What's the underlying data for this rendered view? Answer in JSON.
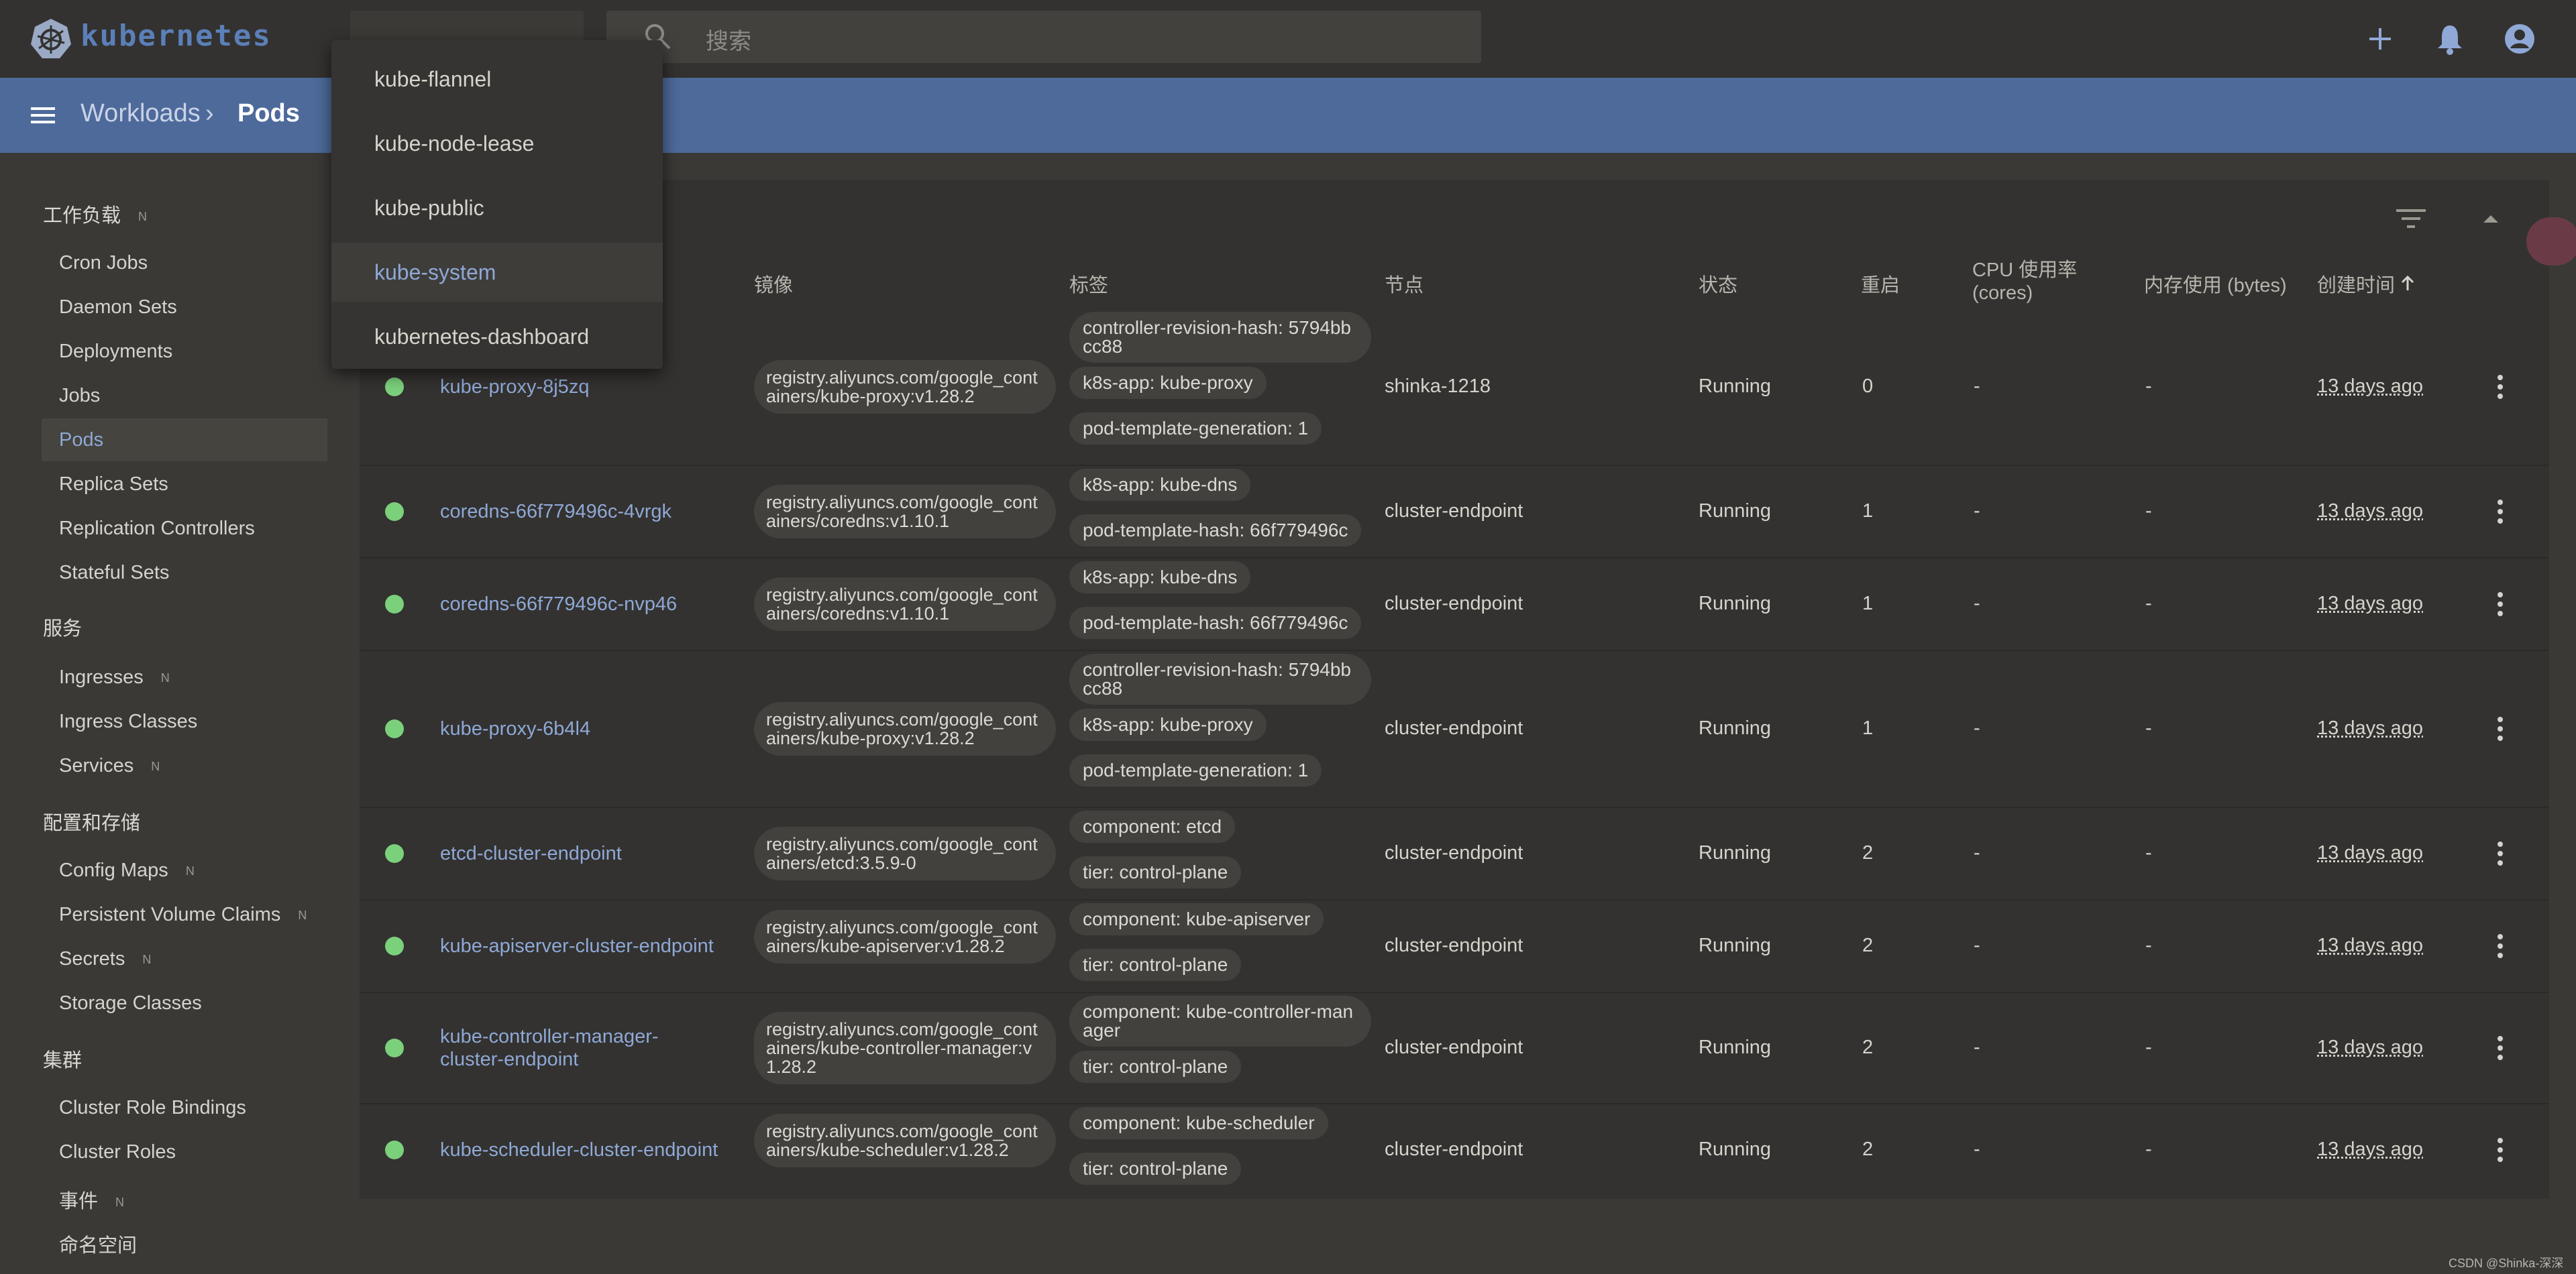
{
  "app": {
    "brand": "kubernetes"
  },
  "search": {
    "placeholder": "搜索"
  },
  "header": {
    "breadcrumb": [
      "Workloads",
      "Pods"
    ],
    "separator": "›"
  },
  "sidebar": {
    "sections": [
      {
        "title": "工作负载",
        "badge": "N"
      },
      {
        "title": "服务"
      },
      {
        "title": "配置和存储"
      },
      {
        "title": "集群"
      }
    ],
    "workloads": [
      "Cron Jobs",
      "Daemon Sets",
      "Deployments",
      "Jobs",
      "Pods",
      "Replica Sets",
      "Replication Controllers",
      "Stateful Sets"
    ],
    "services": [
      {
        "label": "Ingresses",
        "badge": "N"
      },
      {
        "label": "Ingress Classes"
      },
      {
        "label": "Services",
        "badge": "N"
      }
    ],
    "config": [
      {
        "label": "Config Maps",
        "badge": "N"
      },
      {
        "label": "Persistent Volume Claims",
        "badge": "N"
      },
      {
        "label": "Secrets",
        "badge": "N"
      },
      {
        "label": "Storage Classes"
      }
    ],
    "cluster": [
      {
        "label": "Cluster Role Bindings"
      },
      {
        "label": "Cluster Roles"
      },
      {
        "label": "事件",
        "badge": "N"
      },
      {
        "label": "命名空间"
      }
    ],
    "active": "Pods"
  },
  "namespace_dropdown": {
    "options": [
      "kube-flannel",
      "kube-node-lease",
      "kube-public",
      "kube-system",
      "kubernetes-dashboard"
    ],
    "selected": "kube-system"
  },
  "table": {
    "headers": {
      "image": "镜像",
      "labels": "标签",
      "node": "节点",
      "status": "状态",
      "restarts": "重启",
      "cpu": "CPU 使用率\n(cores)",
      "memory": "内存使用 (bytes)",
      "created": "创建时间"
    },
    "sort_icon": "arrow-up-icon",
    "rows": [
      {
        "name": "kube-proxy-8j5zq",
        "image": "registry.aliyuncs.com/google_containers/kube-proxy:v1.28.2",
        "labels": [
          "controller-revision-hash: 5794bbcc88",
          "k8s-app: kube-proxy",
          "pod-template-generation: 1"
        ],
        "node": "shinka-1218",
        "status": "Running",
        "restarts": "0",
        "cpu": "-",
        "memory": "-",
        "created": "13 days ago"
      },
      {
        "name": "coredns-66f779496c-4vrgk",
        "image": "registry.aliyuncs.com/google_containers/coredns:v1.10.1",
        "labels": [
          "k8s-app: kube-dns",
          "pod-template-hash: 66f779496c"
        ],
        "node": "cluster-endpoint",
        "status": "Running",
        "restarts": "1",
        "cpu": "-",
        "memory": "-",
        "created": "13 days ago"
      },
      {
        "name": "coredns-66f779496c-nvp46",
        "image": "registry.aliyuncs.com/google_containers/coredns:v1.10.1",
        "labels": [
          "k8s-app: kube-dns",
          "pod-template-hash: 66f779496c"
        ],
        "node": "cluster-endpoint",
        "status": "Running",
        "restarts": "1",
        "cpu": "-",
        "memory": "-",
        "created": "13 days ago"
      },
      {
        "name": "kube-proxy-6b4l4",
        "image": "registry.aliyuncs.com/google_containers/kube-proxy:v1.28.2",
        "labels": [
          "controller-revision-hash: 5794bbcc88",
          "k8s-app: kube-proxy",
          "pod-template-generation: 1"
        ],
        "node": "cluster-endpoint",
        "status": "Running",
        "restarts": "1",
        "cpu": "-",
        "memory": "-",
        "created": "13 days ago"
      },
      {
        "name": "etcd-cluster-endpoint",
        "image": "registry.aliyuncs.com/google_containers/etcd:3.5.9-0",
        "labels": [
          "component: etcd",
          "tier: control-plane"
        ],
        "node": "cluster-endpoint",
        "status": "Running",
        "restarts": "2",
        "cpu": "-",
        "memory": "-",
        "created": "13 days ago"
      },
      {
        "name": "kube-apiserver-cluster-endpoint",
        "image": "registry.aliyuncs.com/google_containers/kube-apiserver:v1.28.2",
        "labels": [
          "component: kube-apiserver",
          "tier: control-plane"
        ],
        "node": "cluster-endpoint",
        "status": "Running",
        "restarts": "2",
        "cpu": "-",
        "memory": "-",
        "created": "13 days ago"
      },
      {
        "name": "kube-controller-manager-cluster-endpoint",
        "image": "registry.aliyuncs.com/google_containers/kube-controller-manager:v1.28.2",
        "labels": [
          "component: kube-controller-manager",
          "tier: control-plane"
        ],
        "node": "cluster-endpoint",
        "status": "Running",
        "restarts": "2",
        "cpu": "-",
        "memory": "-",
        "created": "13 days ago"
      },
      {
        "name": "kube-scheduler-cluster-endpoint",
        "image": "registry.aliyuncs.com/google_containers/kube-scheduler:v1.28.2",
        "labels": [
          "component: kube-scheduler",
          "tier: control-plane"
        ],
        "node": "cluster-endpoint",
        "status": "Running",
        "restarts": "2",
        "cpu": "-",
        "memory": "-",
        "created": "13 days ago"
      }
    ]
  },
  "watermark": "CSDN @Shinka-深深",
  "colors": {
    "header": "#4e6a9b",
    "running": "#7bd07c",
    "link": "#8fa8d6"
  }
}
